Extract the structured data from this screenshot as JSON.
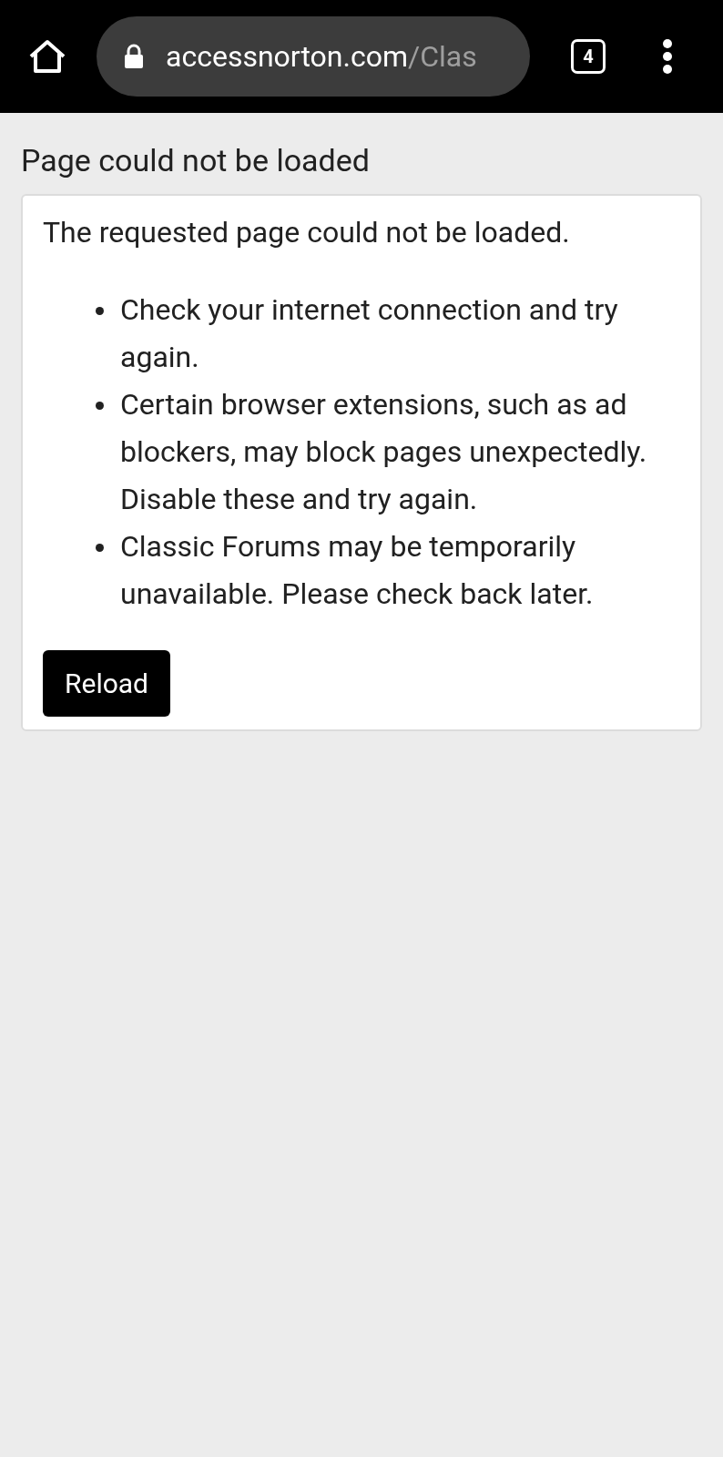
{
  "browser_bar": {
    "url_host": "accessnorton.com",
    "url_path": "/Clas",
    "tab_count": "4"
  },
  "page_title": "Page could not be loaded",
  "message": "The requested page could not be loaded.",
  "tips": [
    "Check your internet connection and try again.",
    "Certain browser extensions, such as ad blockers, may block pages unexpectedly. Disable these and try again.",
    "Classic Forums may be temporarily unavailable. Please check back later."
  ],
  "button": "Reload"
}
